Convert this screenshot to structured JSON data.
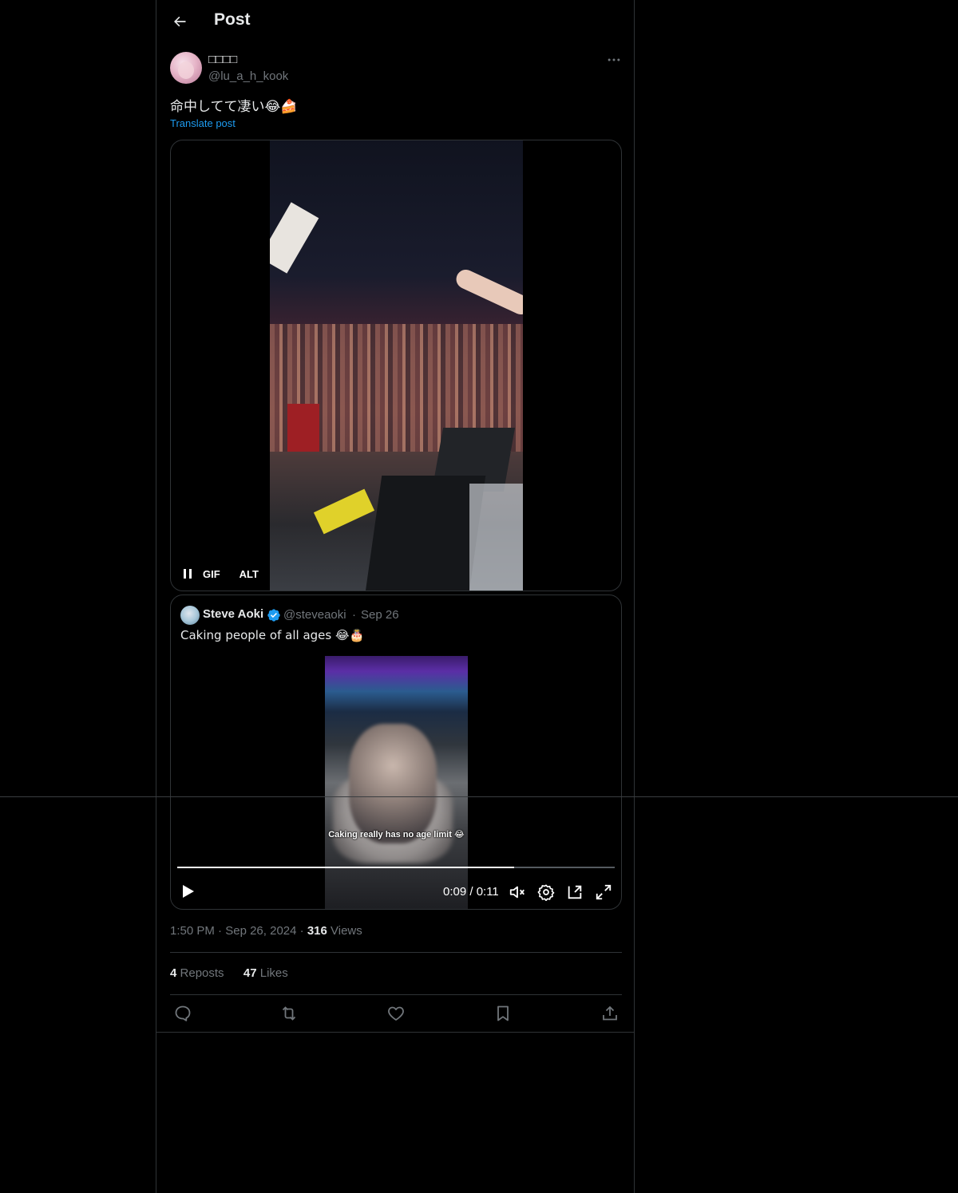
{
  "header": {
    "title": "Post"
  },
  "post": {
    "author_name": "□□□□",
    "author_handle": "@lu_a_h_kook",
    "text": "命中してて凄い😂🍰",
    "translate_label": "Translate post",
    "media_controls": {
      "gif_label": "GIF",
      "alt_label": "ALT"
    }
  },
  "quote": {
    "author_name": "Steve Aoki",
    "author_handle": "@steveaoki",
    "separator": "·",
    "date": "Sep 26",
    "text": "Caking people of all ages 😂🎂",
    "video_caption": "Caking really has no age limit 😂",
    "timecode": "0:09 / 0:11",
    "progress": 0.77
  },
  "meta": {
    "time": "1:50 PM",
    "date": "Sep 26, 2024",
    "views_count": "316",
    "views_label": "Views"
  },
  "stats": {
    "reposts_count": "4",
    "reposts_label": "Reposts",
    "likes_count": "47",
    "likes_label": "Likes"
  },
  "colors": {
    "accent": "#1d9bf0",
    "muted": "#71767b",
    "text": "#e7e9ea",
    "border": "#2f3336"
  }
}
